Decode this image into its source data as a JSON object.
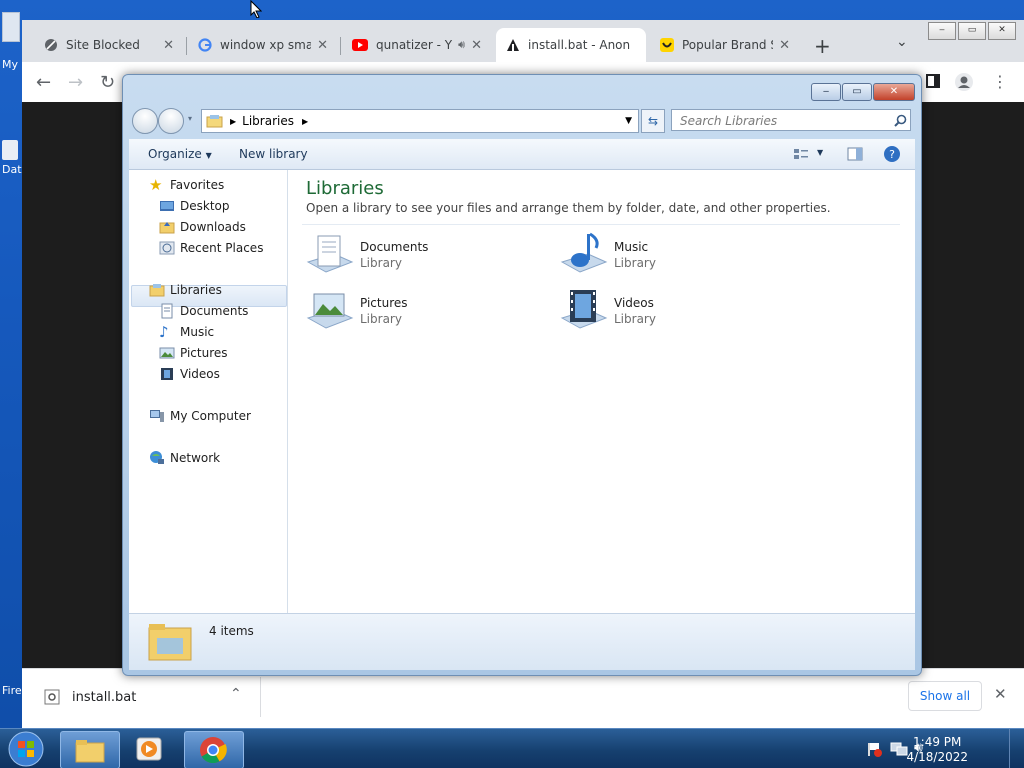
{
  "desktop": {
    "icon_label_1": "My",
    "icon_label_2": "Dat",
    "icon_label_3": "Fire"
  },
  "browser": {
    "tabs": [
      {
        "title": "Site Blocked",
        "icon": "blocked-globe-icon"
      },
      {
        "title": "window xp small",
        "icon": "google-g-icon"
      },
      {
        "title": "qunatizer - Y",
        "icon": "youtube-icon",
        "audio_icon": "speaker-icon"
      },
      {
        "title": "install.bat - Anon",
        "icon": "anon-file-icon"
      },
      {
        "title": "Popular Brand Sto",
        "icon": "smiley-icon"
      }
    ],
    "new_tab_label": "+",
    "tab_search_label": "⌄",
    "download": {
      "file_name": "install.bat",
      "show_all_label": "Show all"
    }
  },
  "explorer": {
    "address": {
      "crumb": "Libraries"
    },
    "search_placeholder": "Search Libraries",
    "commands": {
      "organize": "Organize",
      "new_library": "New library"
    },
    "nav": {
      "favorites": "Favorites",
      "favorites_items": [
        "Desktop",
        "Downloads",
        "Recent Places"
      ],
      "libraries": "Libraries",
      "libraries_items": [
        "Documents",
        "Music",
        "Pictures",
        "Videos"
      ],
      "computer": "My Computer",
      "network": "Network"
    },
    "main": {
      "title": "Libraries",
      "description": "Open a library to see your files and arrange them by folder, date, and other properties.",
      "items": [
        {
          "name": "Documents",
          "type": "Library"
        },
        {
          "name": "Music",
          "type": "Library"
        },
        {
          "name": "Pictures",
          "type": "Library"
        },
        {
          "name": "Videos",
          "type": "Library"
        }
      ]
    },
    "status": {
      "count": "4 items"
    }
  },
  "taskbar": {
    "time": "1:49 PM",
    "date": "4/18/2022"
  },
  "colors": {
    "accent_title": "#1e6a36",
    "taskbar": "#16406f",
    "chrome_frame": "#dee1e6"
  }
}
